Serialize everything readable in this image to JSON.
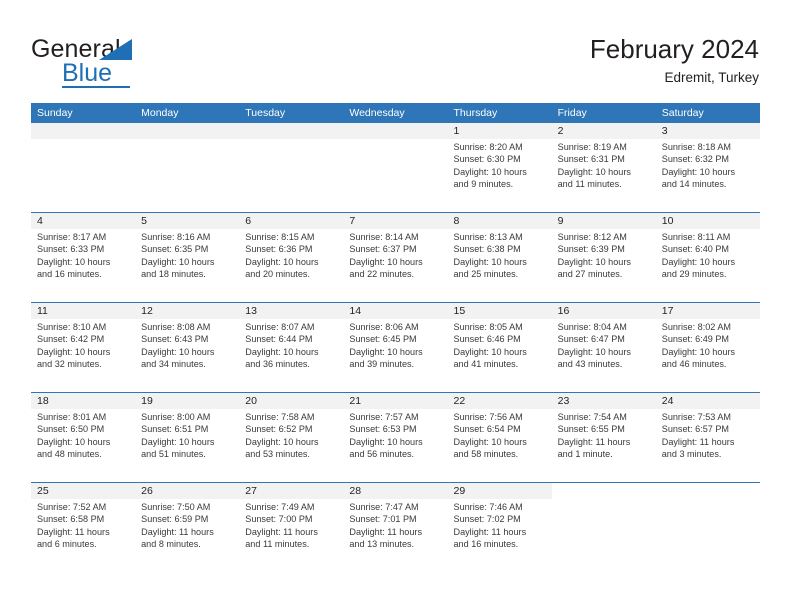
{
  "logo": {
    "text_primary": "General",
    "text_secondary": "Blue",
    "triangle_icon": "logo-triangle-icon"
  },
  "header": {
    "title": "February 2024",
    "subtitle": "Edremit, Turkey"
  },
  "colors": {
    "header_blue": "#2e76b8",
    "daynum_band": "#f2f2f2",
    "text": "#231f20",
    "logo_blue": "#1f6fb5"
  },
  "weekdays": [
    "Sunday",
    "Monday",
    "Tuesday",
    "Wednesday",
    "Thursday",
    "Friday",
    "Saturday"
  ],
  "labels": {
    "sunrise": "Sunrise:",
    "sunset": "Sunset:",
    "daylight": "Daylight:"
  },
  "weeks": [
    [
      {
        "day": "",
        "empty": true
      },
      {
        "day": "",
        "empty": true
      },
      {
        "day": "",
        "empty": true
      },
      {
        "day": "",
        "empty": true
      },
      {
        "day": "1",
        "sunrise": "Sunrise: 8:20 AM",
        "sunset": "Sunset: 6:30 PM",
        "daylight1": "Daylight: 10 hours",
        "daylight2": "and 9 minutes."
      },
      {
        "day": "2",
        "sunrise": "Sunrise: 8:19 AM",
        "sunset": "Sunset: 6:31 PM",
        "daylight1": "Daylight: 10 hours",
        "daylight2": "and 11 minutes."
      },
      {
        "day": "3",
        "sunrise": "Sunrise: 8:18 AM",
        "sunset": "Sunset: 6:32 PM",
        "daylight1": "Daylight: 10 hours",
        "daylight2": "and 14 minutes."
      }
    ],
    [
      {
        "day": "4",
        "sunrise": "Sunrise: 8:17 AM",
        "sunset": "Sunset: 6:33 PM",
        "daylight1": "Daylight: 10 hours",
        "daylight2": "and 16 minutes."
      },
      {
        "day": "5",
        "sunrise": "Sunrise: 8:16 AM",
        "sunset": "Sunset: 6:35 PM",
        "daylight1": "Daylight: 10 hours",
        "daylight2": "and 18 minutes."
      },
      {
        "day": "6",
        "sunrise": "Sunrise: 8:15 AM",
        "sunset": "Sunset: 6:36 PM",
        "daylight1": "Daylight: 10 hours",
        "daylight2": "and 20 minutes."
      },
      {
        "day": "7",
        "sunrise": "Sunrise: 8:14 AM",
        "sunset": "Sunset: 6:37 PM",
        "daylight1": "Daylight: 10 hours",
        "daylight2": "and 22 minutes."
      },
      {
        "day": "8",
        "sunrise": "Sunrise: 8:13 AM",
        "sunset": "Sunset: 6:38 PM",
        "daylight1": "Daylight: 10 hours",
        "daylight2": "and 25 minutes."
      },
      {
        "day": "9",
        "sunrise": "Sunrise: 8:12 AM",
        "sunset": "Sunset: 6:39 PM",
        "daylight1": "Daylight: 10 hours",
        "daylight2": "and 27 minutes."
      },
      {
        "day": "10",
        "sunrise": "Sunrise: 8:11 AM",
        "sunset": "Sunset: 6:40 PM",
        "daylight1": "Daylight: 10 hours",
        "daylight2": "and 29 minutes."
      }
    ],
    [
      {
        "day": "11",
        "sunrise": "Sunrise: 8:10 AM",
        "sunset": "Sunset: 6:42 PM",
        "daylight1": "Daylight: 10 hours",
        "daylight2": "and 32 minutes."
      },
      {
        "day": "12",
        "sunrise": "Sunrise: 8:08 AM",
        "sunset": "Sunset: 6:43 PM",
        "daylight1": "Daylight: 10 hours",
        "daylight2": "and 34 minutes."
      },
      {
        "day": "13",
        "sunrise": "Sunrise: 8:07 AM",
        "sunset": "Sunset: 6:44 PM",
        "daylight1": "Daylight: 10 hours",
        "daylight2": "and 36 minutes."
      },
      {
        "day": "14",
        "sunrise": "Sunrise: 8:06 AM",
        "sunset": "Sunset: 6:45 PM",
        "daylight1": "Daylight: 10 hours",
        "daylight2": "and 39 minutes."
      },
      {
        "day": "15",
        "sunrise": "Sunrise: 8:05 AM",
        "sunset": "Sunset: 6:46 PM",
        "daylight1": "Daylight: 10 hours",
        "daylight2": "and 41 minutes."
      },
      {
        "day": "16",
        "sunrise": "Sunrise: 8:04 AM",
        "sunset": "Sunset: 6:47 PM",
        "daylight1": "Daylight: 10 hours",
        "daylight2": "and 43 minutes."
      },
      {
        "day": "17",
        "sunrise": "Sunrise: 8:02 AM",
        "sunset": "Sunset: 6:49 PM",
        "daylight1": "Daylight: 10 hours",
        "daylight2": "and 46 minutes."
      }
    ],
    [
      {
        "day": "18",
        "sunrise": "Sunrise: 8:01 AM",
        "sunset": "Sunset: 6:50 PM",
        "daylight1": "Daylight: 10 hours",
        "daylight2": "and 48 minutes."
      },
      {
        "day": "19",
        "sunrise": "Sunrise: 8:00 AM",
        "sunset": "Sunset: 6:51 PM",
        "daylight1": "Daylight: 10 hours",
        "daylight2": "and 51 minutes."
      },
      {
        "day": "20",
        "sunrise": "Sunrise: 7:58 AM",
        "sunset": "Sunset: 6:52 PM",
        "daylight1": "Daylight: 10 hours",
        "daylight2": "and 53 minutes."
      },
      {
        "day": "21",
        "sunrise": "Sunrise: 7:57 AM",
        "sunset": "Sunset: 6:53 PM",
        "daylight1": "Daylight: 10 hours",
        "daylight2": "and 56 minutes."
      },
      {
        "day": "22",
        "sunrise": "Sunrise: 7:56 AM",
        "sunset": "Sunset: 6:54 PM",
        "daylight1": "Daylight: 10 hours",
        "daylight2": "and 58 minutes."
      },
      {
        "day": "23",
        "sunrise": "Sunrise: 7:54 AM",
        "sunset": "Sunset: 6:55 PM",
        "daylight1": "Daylight: 11 hours",
        "daylight2": "and 1 minute."
      },
      {
        "day": "24",
        "sunrise": "Sunrise: 7:53 AM",
        "sunset": "Sunset: 6:57 PM",
        "daylight1": "Daylight: 11 hours",
        "daylight2": "and 3 minutes."
      }
    ],
    [
      {
        "day": "25",
        "sunrise": "Sunrise: 7:52 AM",
        "sunset": "Sunset: 6:58 PM",
        "daylight1": "Daylight: 11 hours",
        "daylight2": "and 6 minutes."
      },
      {
        "day": "26",
        "sunrise": "Sunrise: 7:50 AM",
        "sunset": "Sunset: 6:59 PM",
        "daylight1": "Daylight: 11 hours",
        "daylight2": "and 8 minutes."
      },
      {
        "day": "27",
        "sunrise": "Sunrise: 7:49 AM",
        "sunset": "Sunset: 7:00 PM",
        "daylight1": "Daylight: 11 hours",
        "daylight2": "and 11 minutes."
      },
      {
        "day": "28",
        "sunrise": "Sunrise: 7:47 AM",
        "sunset": "Sunset: 7:01 PM",
        "daylight1": "Daylight: 11 hours",
        "daylight2": "and 13 minutes."
      },
      {
        "day": "29",
        "sunrise": "Sunrise: 7:46 AM",
        "sunset": "Sunset: 7:02 PM",
        "daylight1": "Daylight: 11 hours",
        "daylight2": "and 16 minutes."
      },
      {
        "day": "",
        "empty": true,
        "noband": true
      },
      {
        "day": "",
        "empty": true,
        "noband": true
      }
    ]
  ]
}
